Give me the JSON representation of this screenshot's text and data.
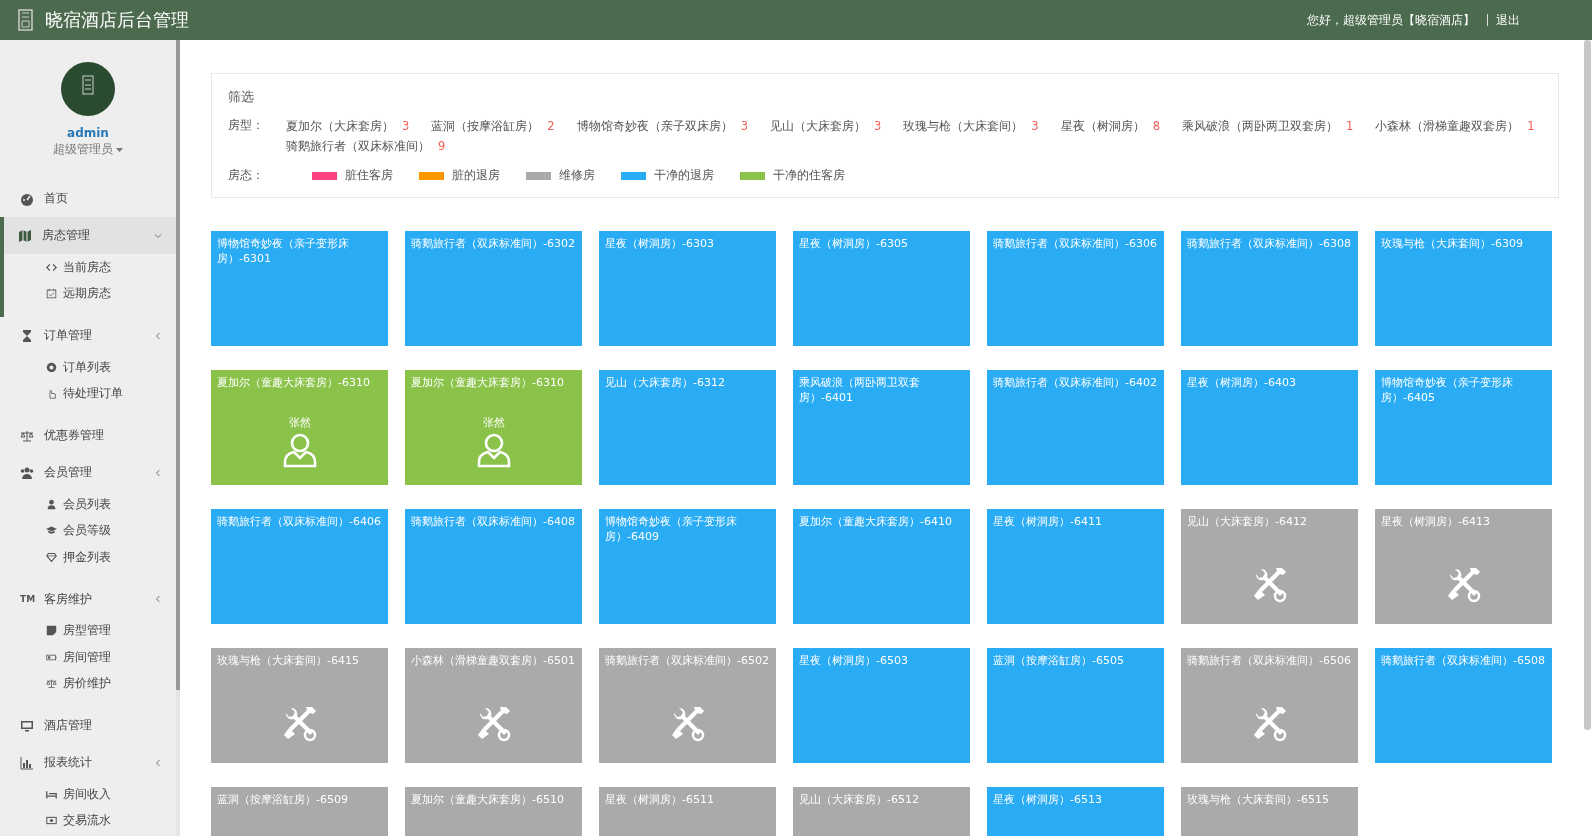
{
  "header": {
    "title": "晓宿酒店后台管理",
    "greeting": "您好，超级管理员【晓宿酒店】",
    "logout": "退出"
  },
  "sidebar": {
    "profile": {
      "name": "admin",
      "role": "超级管理员"
    },
    "menu": [
      {
        "label": "首页",
        "selected": false
      },
      {
        "label": "房态管理",
        "selected": true,
        "expanded": true,
        "children": [
          {
            "label": "当前房态"
          },
          {
            "label": "远期房态"
          }
        ]
      },
      {
        "label": "订单管理",
        "selected": false,
        "expanded": false,
        "children": [
          {
            "label": "订单列表"
          },
          {
            "label": "待处理订单"
          }
        ]
      },
      {
        "label": "优惠券管理",
        "selected": false
      },
      {
        "label": "会员管理",
        "selected": false,
        "expanded": false,
        "children": [
          {
            "label": "会员列表"
          },
          {
            "label": "会员等级"
          },
          {
            "label": "押金列表"
          }
        ]
      },
      {
        "label": "客房维护",
        "icon_text": "TM",
        "selected": false,
        "expanded": false,
        "children": [
          {
            "label": "房型管理"
          },
          {
            "label": "房间管理"
          },
          {
            "label": "房价维护"
          }
        ]
      },
      {
        "label": "酒店管理",
        "selected": false
      },
      {
        "label": "报表统计",
        "selected": false,
        "expanded": false,
        "children": [
          {
            "label": "房间收入"
          },
          {
            "label": "交易流水"
          }
        ]
      }
    ]
  },
  "filter": {
    "title": "筛选",
    "room_type_label": "房型：",
    "room_types": [
      {
        "name": "夏加尔（大床套房）",
        "count": "3"
      },
      {
        "name": "蓝洞（按摩浴缸房）",
        "count": "2"
      },
      {
        "name": "博物馆奇妙夜（亲子双床房）",
        "count": "3"
      },
      {
        "name": "见山（大床套房）",
        "count": "3"
      },
      {
        "name": "玫瑰与枪（大床套间）",
        "count": "3"
      },
      {
        "name": "星夜（树洞房）",
        "count": "8"
      },
      {
        "name": "乘风破浪（两卧两卫双套房）",
        "count": "1"
      },
      {
        "name": "小森林（滑梯童趣双套房）",
        "count": "1"
      },
      {
        "name": "骑鹅旅行者（双床标准间）",
        "count": "9"
      }
    ],
    "status_label": "房态：",
    "statuses": [
      {
        "kind": "dirty_occupied",
        "label": "脏住客房",
        "color": "#ff4081"
      },
      {
        "kind": "dirty_checkout",
        "label": "脏的退房",
        "color": "#ff9800"
      },
      {
        "kind": "maintenance",
        "label": "维修房",
        "color": "#aaaaaa"
      },
      {
        "kind": "clean_checkout",
        "label": "干净的退房",
        "color": "#2aacf5"
      },
      {
        "kind": "clean_occupied",
        "label": "干净的住客房",
        "color": "#8bc34a"
      }
    ]
  },
  "rooms": [
    {
      "label": "博物馆奇妙夜（亲子变形床房）-6301",
      "kind": "clean_checkout"
    },
    {
      "label": "骑鹅旅行者（双床标准间）-6302",
      "kind": "clean_checkout"
    },
    {
      "label": "星夜（树洞房）-6303",
      "kind": "clean_checkout"
    },
    {
      "label": "星夜（树洞房）-6305",
      "kind": "clean_checkout"
    },
    {
      "label": "骑鹅旅行者（双床标准间）-6306",
      "kind": "clean_checkout"
    },
    {
      "label": "骑鹅旅行者（双床标准间）-6308",
      "kind": "clean_checkout"
    },
    {
      "label": "玫瑰与枪（大床套间）-6309",
      "kind": "clean_checkout"
    },
    {
      "label": "夏加尔（童趣大床套房）-6310",
      "kind": "clean_occupied",
      "guest": "张然"
    },
    {
      "label": "夏加尔（童趣大床套房）-6310",
      "kind": "clean_occupied",
      "guest": "张然"
    },
    {
      "label": "见山（大床套房）-6312",
      "kind": "clean_checkout"
    },
    {
      "label": "乘风破浪（两卧两卫双套房）-6401",
      "kind": "clean_checkout"
    },
    {
      "label": "骑鹅旅行者（双床标准间）-6402",
      "kind": "clean_checkout"
    },
    {
      "label": "星夜（树洞房）-6403",
      "kind": "clean_checkout"
    },
    {
      "label": "博物馆奇妙夜（亲子变形床房）-6405",
      "kind": "clean_checkout"
    },
    {
      "label": "骑鹅旅行者（双床标准间）-6406",
      "kind": "clean_checkout"
    },
    {
      "label": "骑鹅旅行者（双床标准间）-6408",
      "kind": "clean_checkout"
    },
    {
      "label": "博物馆奇妙夜（亲子变形床房）-6409",
      "kind": "clean_checkout"
    },
    {
      "label": "夏加尔（童趣大床套房）-6410",
      "kind": "clean_checkout"
    },
    {
      "label": "星夜（树洞房）-6411",
      "kind": "clean_checkout"
    },
    {
      "label": "见山（大床套房）-6412",
      "kind": "maintenance"
    },
    {
      "label": "星夜（树洞房）-6413",
      "kind": "maintenance"
    },
    {
      "label": "玫瑰与枪（大床套间）-6415",
      "kind": "maintenance"
    },
    {
      "label": "小森林（滑梯童趣双套房）-6501",
      "kind": "maintenance"
    },
    {
      "label": "骑鹅旅行者（双床标准间）-6502",
      "kind": "maintenance"
    },
    {
      "label": "星夜（树洞房）-6503",
      "kind": "clean_checkout"
    },
    {
      "label": "蓝洞（按摩浴缸房）-6505",
      "kind": "clean_checkout"
    },
    {
      "label": "骑鹅旅行者（双床标准间）-6506",
      "kind": "maintenance"
    },
    {
      "label": "骑鹅旅行者（双床标准间）-6508",
      "kind": "clean_checkout"
    },
    {
      "label": "蓝洞（按摩浴缸房）-6509",
      "kind": "maintenance"
    },
    {
      "label": "夏加尔（童趣大床套房）-6510",
      "kind": "maintenance"
    },
    {
      "label": "星夜（树洞房）-6511",
      "kind": "maintenance"
    },
    {
      "label": "见山（大床套房）-6512",
      "kind": "maintenance"
    },
    {
      "label": "星夜（树洞房）-6513",
      "kind": "clean_checkout"
    },
    {
      "label": "玫瑰与枪（大床套间）-6515",
      "kind": "maintenance"
    }
  ]
}
